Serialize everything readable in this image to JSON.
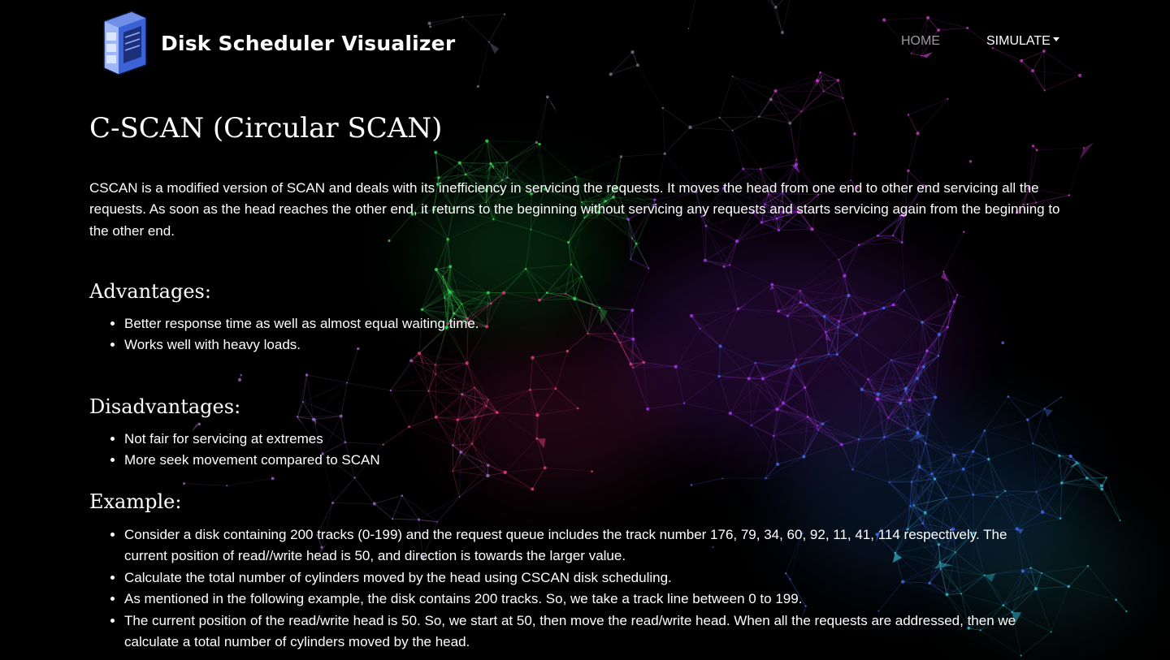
{
  "brand": {
    "title": "Disk Scheduler Visualizer",
    "logo_icon": "disk-drive-icon"
  },
  "nav": {
    "home": "HOME",
    "simulate": "SIMULATE"
  },
  "page": {
    "title": "C-SCAN (Circular SCAN)",
    "intro": "CSCAN is a modified version of SCAN and deals with its inefficiency in servicing the requests. It moves the head from one end to other end servicing all the requests. As soon as the head reaches the other end, it returns to the beginning without servicing any requests and starts servicing again from the beginning to the other end."
  },
  "advantages": {
    "heading": "Advantages:",
    "items": [
      "Better response time as well as almost equal waiting time.",
      "Works well with heavy loads."
    ]
  },
  "disadvantages": {
    "heading": "Disadvantages:",
    "items": [
      "Not fair for servicing at extremes",
      "More seek movement compared to SCAN"
    ]
  },
  "example": {
    "heading": "Example:",
    "items": [
      "Consider a disk containing 200 tracks (0-199) and the request queue includes the track number 176, 79, 34, 60, 92, 11, 41, 114 respectively. The current position of read//write head is 50, and direction is towards the larger value.",
      "Calculate the total number of cylinders moved by the head using CSCAN disk scheduling.",
      "As mentioned in the following example, the disk contains 200 tracks. So, we take a track line between 0 to 199.",
      "The current position of the read/write head is 50. So, we start at 50, then move the read/write head. When all the requests are addressed, then we calculate a total number of cylinders moved by the head."
    ]
  },
  "colors": {
    "background": "#000000",
    "text": "#ffffff",
    "nav_inactive": "#9a9a9a"
  }
}
